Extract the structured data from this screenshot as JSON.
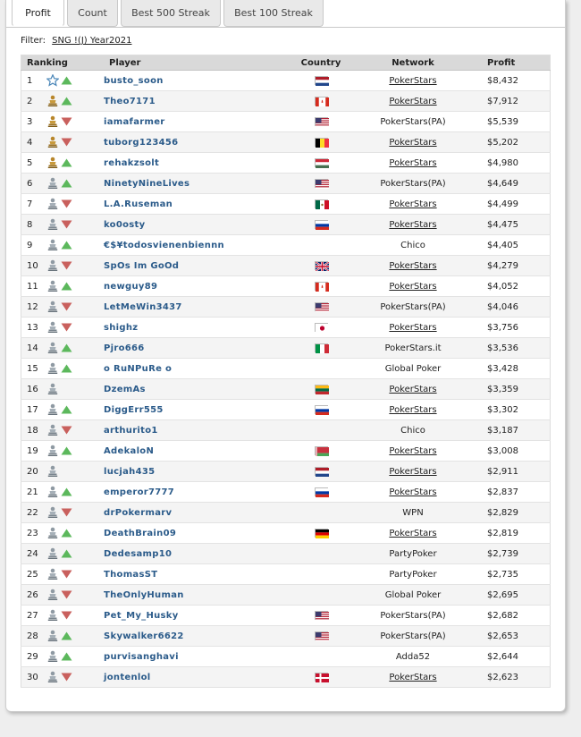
{
  "tabs": [
    {
      "label": "Profit",
      "active": true
    },
    {
      "label": "Count",
      "active": false
    },
    {
      "label": "Best 500 Streak",
      "active": false
    },
    {
      "label": "Best 100 Streak",
      "active": false
    }
  ],
  "filter": {
    "label": "Filter:",
    "value": "SNG !(J) Year2021"
  },
  "table": {
    "headers": {
      "ranking": "Ranking",
      "player": "Player",
      "country": "Country",
      "network": "Network",
      "profit": "Profit"
    },
    "rows": [
      {
        "rank": "1",
        "badge": "star",
        "trend": "up",
        "player": "busto_soon",
        "flag": "nl",
        "network": "PokerStars",
        "link": true,
        "profit": "$8,432"
      },
      {
        "rank": "2",
        "badge": "gold",
        "trend": "up",
        "player": "Theo7171",
        "flag": "ca",
        "network": "PokerStars",
        "link": true,
        "profit": "$7,912"
      },
      {
        "rank": "3",
        "badge": "gold",
        "trend": "down",
        "player": "iamafarmer",
        "flag": "us",
        "network": "PokerStars(PA)",
        "link": false,
        "profit": "$5,539"
      },
      {
        "rank": "4",
        "badge": "gold",
        "trend": "down",
        "player": "tuborg123456",
        "flag": "be",
        "network": "PokerStars",
        "link": true,
        "profit": "$5,202"
      },
      {
        "rank": "5",
        "badge": "gold",
        "trend": "up",
        "player": "rehakzsolt",
        "flag": "hu",
        "network": "PokerStars",
        "link": true,
        "profit": "$4,980"
      },
      {
        "rank": "6",
        "badge": "silver",
        "trend": "up",
        "player": "NinetyNineLives",
        "flag": "us",
        "network": "PokerStars(PA)",
        "link": false,
        "profit": "$4,649"
      },
      {
        "rank": "7",
        "badge": "silver",
        "trend": "down",
        "player": "L.A.Ruseman",
        "flag": "mx",
        "network": "PokerStars",
        "link": true,
        "profit": "$4,499"
      },
      {
        "rank": "8",
        "badge": "silver",
        "trend": "down",
        "player": "ko0osty",
        "flag": "ru",
        "network": "PokerStars",
        "link": true,
        "profit": "$4,475"
      },
      {
        "rank": "9",
        "badge": "silver",
        "trend": "up",
        "player": "€$¥todosvienenbiennn",
        "flag": "",
        "network": "Chico",
        "link": false,
        "profit": "$4,405"
      },
      {
        "rank": "10",
        "badge": "silver",
        "trend": "down",
        "player": "SpOs Im GoOd",
        "flag": "gb",
        "network": "PokerStars",
        "link": true,
        "profit": "$4,279"
      },
      {
        "rank": "11",
        "badge": "silver",
        "trend": "up",
        "player": "newguy89",
        "flag": "ca",
        "network": "PokerStars",
        "link": true,
        "profit": "$4,052"
      },
      {
        "rank": "12",
        "badge": "silver",
        "trend": "down",
        "player": "LetMeWin3437",
        "flag": "us",
        "network": "PokerStars(PA)",
        "link": false,
        "profit": "$4,046"
      },
      {
        "rank": "13",
        "badge": "silver",
        "trend": "down",
        "player": "shighz",
        "flag": "jp",
        "network": "PokerStars",
        "link": true,
        "profit": "$3,756"
      },
      {
        "rank": "14",
        "badge": "silver",
        "trend": "up",
        "player": "Pjro666",
        "flag": "it",
        "network": "PokerStars.it",
        "link": false,
        "profit": "$3,536"
      },
      {
        "rank": "15",
        "badge": "silver",
        "trend": "up",
        "player": "o RuNPuRe o",
        "flag": "",
        "network": "Global Poker",
        "link": false,
        "profit": "$3,428"
      },
      {
        "rank": "16",
        "badge": "silver",
        "trend": "none",
        "player": "DzemAs",
        "flag": "lt",
        "network": "PokerStars",
        "link": true,
        "profit": "$3,359"
      },
      {
        "rank": "17",
        "badge": "silver",
        "trend": "up",
        "player": "DiggErr555",
        "flag": "ru",
        "network": "PokerStars",
        "link": true,
        "profit": "$3,302"
      },
      {
        "rank": "18",
        "badge": "silver",
        "trend": "down",
        "player": "arthurito1",
        "flag": "",
        "network": "Chico",
        "link": false,
        "profit": "$3,187"
      },
      {
        "rank": "19",
        "badge": "silver",
        "trend": "up",
        "player": "AdekaloN",
        "flag": "by",
        "network": "PokerStars",
        "link": true,
        "profit": "$3,008"
      },
      {
        "rank": "20",
        "badge": "silver",
        "trend": "none",
        "player": "lucjah435",
        "flag": "nl",
        "network": "PokerStars",
        "link": true,
        "profit": "$2,911"
      },
      {
        "rank": "21",
        "badge": "silver",
        "trend": "up",
        "player": "emperor7777",
        "flag": "ru",
        "network": "PokerStars",
        "link": true,
        "profit": "$2,837"
      },
      {
        "rank": "22",
        "badge": "silver",
        "trend": "down",
        "player": "drPokermarv",
        "flag": "",
        "network": "WPN",
        "link": false,
        "profit": "$2,829"
      },
      {
        "rank": "23",
        "badge": "silver",
        "trend": "up",
        "player": "DeathBrain09",
        "flag": "de",
        "network": "PokerStars",
        "link": true,
        "profit": "$2,819"
      },
      {
        "rank": "24",
        "badge": "silver",
        "trend": "up",
        "player": "Dedesamp10",
        "flag": "",
        "network": "PartyPoker",
        "link": false,
        "profit": "$2,739"
      },
      {
        "rank": "25",
        "badge": "silver",
        "trend": "down",
        "player": "ThomasST",
        "flag": "",
        "network": "PartyPoker",
        "link": false,
        "profit": "$2,735"
      },
      {
        "rank": "26",
        "badge": "silver",
        "trend": "down",
        "player": "TheOnlyHuman",
        "flag": "",
        "network": "Global Poker",
        "link": false,
        "profit": "$2,695"
      },
      {
        "rank": "27",
        "badge": "silver",
        "trend": "down",
        "player": "Pet_My_Husky",
        "flag": "us",
        "network": "PokerStars(PA)",
        "link": false,
        "profit": "$2,682"
      },
      {
        "rank": "28",
        "badge": "silver",
        "trend": "up",
        "player": "Skywalker6622",
        "flag": "us",
        "network": "PokerStars(PA)",
        "link": false,
        "profit": "$2,653"
      },
      {
        "rank": "29",
        "badge": "silver",
        "trend": "up",
        "player": "purvisanghavi",
        "flag": "",
        "network": "Adda52",
        "link": false,
        "profit": "$2,644"
      },
      {
        "rank": "30",
        "badge": "silver",
        "trend": "down",
        "player": "jontenlol",
        "flag": "dk",
        "network": "PokerStars",
        "link": true,
        "profit": "$2,623"
      }
    ]
  },
  "colors": {
    "link": "#2b5b8a",
    "up": "#5cb85c",
    "down": "#c9605d",
    "header_bg": "#d9d9d9"
  }
}
